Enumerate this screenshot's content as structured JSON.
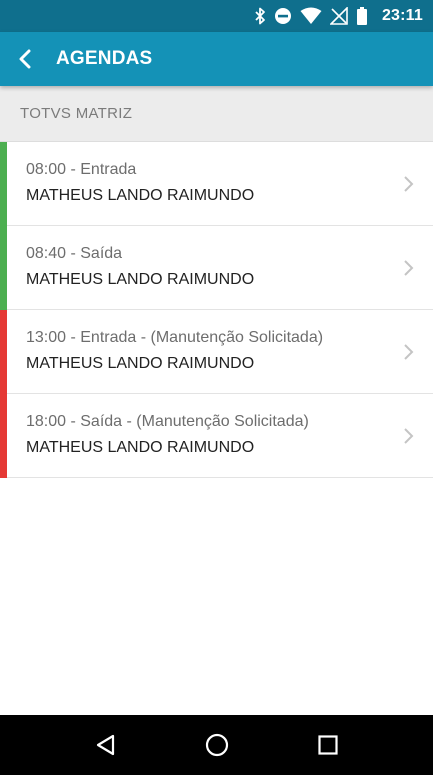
{
  "status_bar": {
    "time": "23:11",
    "icons": [
      "bluetooth-icon",
      "do-not-disturb-icon",
      "wifi-icon",
      "signal-off-icon",
      "battery-icon"
    ]
  },
  "app_bar": {
    "title": "AGENDAS",
    "back_icon": "back-arrow-icon",
    "color": "#1492b7"
  },
  "section": {
    "title": "TOTVS MATRIZ"
  },
  "items": [
    {
      "line1": "08:00 - Entrada",
      "line2": "MATHEUS LANDO RAIMUNDO",
      "status_color": "#4caf50"
    },
    {
      "line1": "08:40 - Saída",
      "line2": "MATHEUS LANDO RAIMUNDO",
      "status_color": "#4caf50"
    },
    {
      "line1": "13:00 - Entrada - (Manutenção Solicitada)",
      "line2": "MATHEUS LANDO RAIMUNDO",
      "status_color": "#e53935"
    },
    {
      "line1": "18:00 - Saída - (Manutenção Solicitada)",
      "line2": "MATHEUS LANDO RAIMUNDO",
      "status_color": "#e53935"
    }
  ],
  "nav_bar": {
    "buttons": [
      "back-triangle-icon",
      "home-circle-icon",
      "recents-square-icon"
    ]
  }
}
